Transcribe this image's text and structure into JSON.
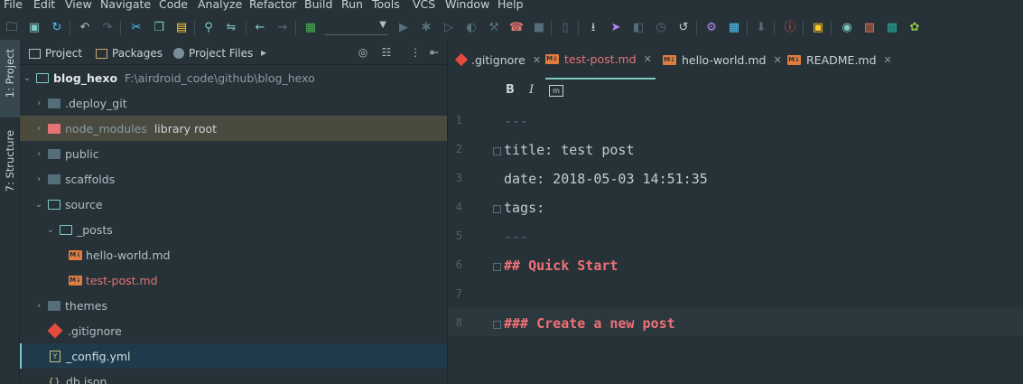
{
  "menu": [
    "File",
    "Edit",
    "View",
    "Navigate",
    "Code",
    "Analyze",
    "Refactor",
    "Build",
    "Run",
    "Tools",
    "VCS",
    "Window",
    "Help"
  ],
  "toolbar": {
    "run_config_value": "",
    "icons": [
      "open-folder-icon",
      "save-icon",
      "sync-icon",
      "undo-icon",
      "redo-icon",
      "cut-icon",
      "copy-icon",
      "paste-icon",
      "find-icon",
      "replace-icon",
      "back-icon",
      "forward-icon",
      "build-icon",
      "run-icon",
      "debug-icon",
      "settings-icon",
      "help-icon"
    ]
  },
  "side_strip": {
    "project_tab": "1: Project",
    "structure_tab": "7: Structure"
  },
  "project_panel": {
    "tabs": [
      {
        "label": "Project",
        "icon": "project-folder-icon"
      },
      {
        "label": "Packages",
        "icon": "packages-icon"
      },
      {
        "label": "Project Files",
        "icon": "project-files-icon"
      }
    ],
    "tree": [
      {
        "name": "blog_hexo",
        "hint": "F:\\airdroid_code\\github\\blog_hexo",
        "type": "root",
        "indent": 0
      },
      {
        "name": ".deploy_git",
        "type": "folder",
        "indent": 1
      },
      {
        "name": "node_modules",
        "hint": "library root",
        "type": "folder-red",
        "indent": 1
      },
      {
        "name": "public",
        "type": "folder",
        "indent": 1
      },
      {
        "name": "scaffolds",
        "type": "folder",
        "indent": 1
      },
      {
        "name": "source",
        "type": "folder-open",
        "indent": 1
      },
      {
        "name": "_posts",
        "type": "folder-open",
        "indent": 2
      },
      {
        "name": "hello-world.md",
        "type": "md",
        "indent": 3
      },
      {
        "name": "test-post.md",
        "type": "md-active",
        "indent": 3
      },
      {
        "name": "themes",
        "type": "folder",
        "indent": 1
      },
      {
        "name": ".gitignore",
        "type": "git",
        "indent": 1
      },
      {
        "name": "_config.yml",
        "type": "yml",
        "indent": 1
      },
      {
        "name": "db.json",
        "type": "json",
        "indent": 1
      }
    ]
  },
  "editor": {
    "tabs": [
      {
        "label": ".gitignore",
        "icon": "git-icon",
        "active": false
      },
      {
        "label": "test-post.md",
        "icon": "markdown-icon",
        "active": true
      },
      {
        "label": "hello-world.md",
        "icon": "markdown-icon",
        "active": false
      },
      {
        "label": "README.md",
        "icon": "markdown-icon",
        "active": false
      }
    ],
    "format_buttons": [
      "B",
      "I"
    ],
    "lines": [
      {
        "num": "1",
        "text": "---",
        "style": "dim"
      },
      {
        "num": "2",
        "text": "title: test post",
        "style": "key"
      },
      {
        "num": "3",
        "text": "date: 2018-05-03 14:51:35",
        "style": "key"
      },
      {
        "num": "4",
        "text": "tags:",
        "style": "key"
      },
      {
        "num": "5",
        "text": "---",
        "style": "dim"
      },
      {
        "num": "6",
        "text": "## Quick Start",
        "style": "head"
      },
      {
        "num": "7",
        "text": "",
        "style": "key"
      },
      {
        "num": "8",
        "text": "### Create a new post",
        "style": "head"
      }
    ]
  },
  "colors": {
    "background": "#263238",
    "accent": "#80cbc4",
    "heading": "#f07178",
    "markdown_icon": "#e07c3e",
    "selection": "#3d4a3f",
    "active_row": "#1f3a4a"
  }
}
